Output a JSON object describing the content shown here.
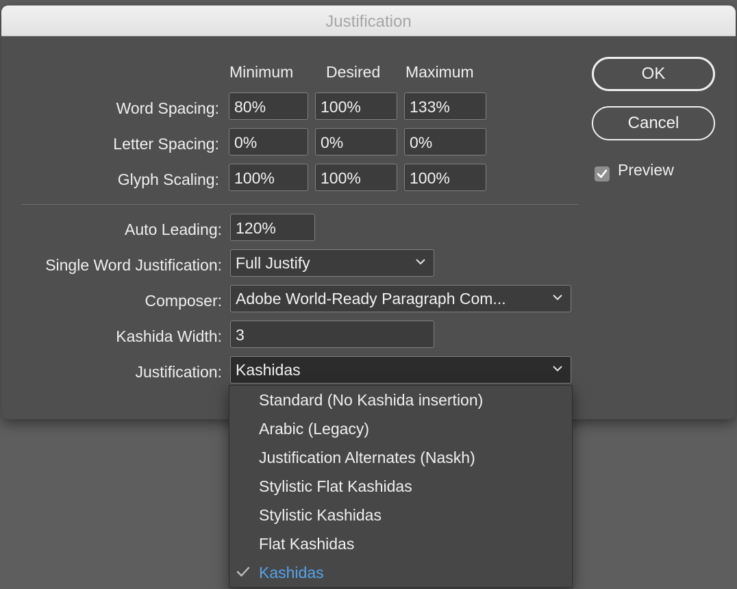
{
  "dialog": {
    "title": "Justification"
  },
  "columns": [
    "Minimum",
    "Desired",
    "Maximum"
  ],
  "rows": [
    {
      "label": "Word Spacing:",
      "values": [
        "80%",
        "100%",
        "133%"
      ]
    },
    {
      "label": "Letter Spacing:",
      "values": [
        "0%",
        "0%",
        "0%"
      ]
    },
    {
      "label": "Glyph Scaling:",
      "values": [
        "100%",
        "100%",
        "100%"
      ]
    }
  ],
  "auto_leading": {
    "label": "Auto Leading:",
    "value": "120%"
  },
  "single_word": {
    "label": "Single Word Justification:",
    "value": "Full Justify"
  },
  "composer": {
    "label": "Composer:",
    "value": "Adobe World-Ready Paragraph Com..."
  },
  "kashida_width": {
    "label": "Kashida Width:",
    "value": "3"
  },
  "justification": {
    "label": "Justification:",
    "value": "Kashidas"
  },
  "buttons": {
    "ok": "OK",
    "cancel": "Cancel"
  },
  "preview": {
    "label": "Preview",
    "checked": true
  },
  "menu": {
    "items": [
      "Standard (No Kashida insertion)",
      "Arabic (Legacy)",
      "Justification Alternates (Naskh)",
      "Stylistic Flat Kashidas",
      "Stylistic Kashidas",
      "Flat Kashidas",
      "Kashidas"
    ],
    "selected": "Kashidas",
    "selected_color": "#54a3ea"
  },
  "icons": {
    "dropdown": "chevron-down-icon",
    "check": "checkmark-icon"
  }
}
